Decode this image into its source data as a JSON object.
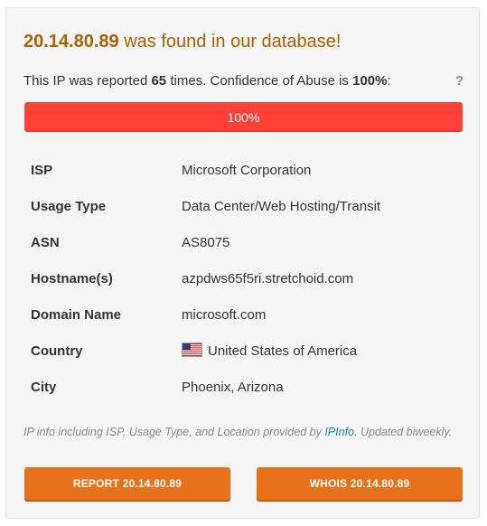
{
  "header": {
    "ip": "20.14.80.89",
    "title_suffix": "was found in our database!"
  },
  "report": {
    "prefix": "This IP was reported",
    "count": "65",
    "middle": "times. Confidence of Abuse is",
    "confidence": "100%",
    "suffix": ":",
    "help_label": "?"
  },
  "progress": {
    "value_percent": 100,
    "label": "100%",
    "fill_color": "#ff4036"
  },
  "details": [
    {
      "key": "ISP",
      "value": "Microsoft Corporation"
    },
    {
      "key": "Usage Type",
      "value": "Data Center/Web Hosting/Transit"
    },
    {
      "key": "ASN",
      "value": "AS8075"
    },
    {
      "key": "Hostname(s)",
      "value": "azpdws65f5ri.stretchoid.com"
    },
    {
      "key": "Domain Name",
      "value": "microsoft.com"
    },
    {
      "key": "Country",
      "value": "United States of America",
      "flag_icon": "us-flag-icon"
    },
    {
      "key": "City",
      "value": "Phoenix, Arizona"
    }
  ],
  "footnote": {
    "before_link": "IP info including ISP, Usage Type, and Location provided by",
    "link_text": "IPInfo",
    "after_link": ". Updated biweekly."
  },
  "buttons": {
    "report_label": "REPORT 20.14.80.89",
    "whois_label": "WHOIS 20.14.80.89",
    "color": "#e8711c"
  },
  "colors": {
    "title": "#a86000",
    "link": "#1c7fa6"
  }
}
